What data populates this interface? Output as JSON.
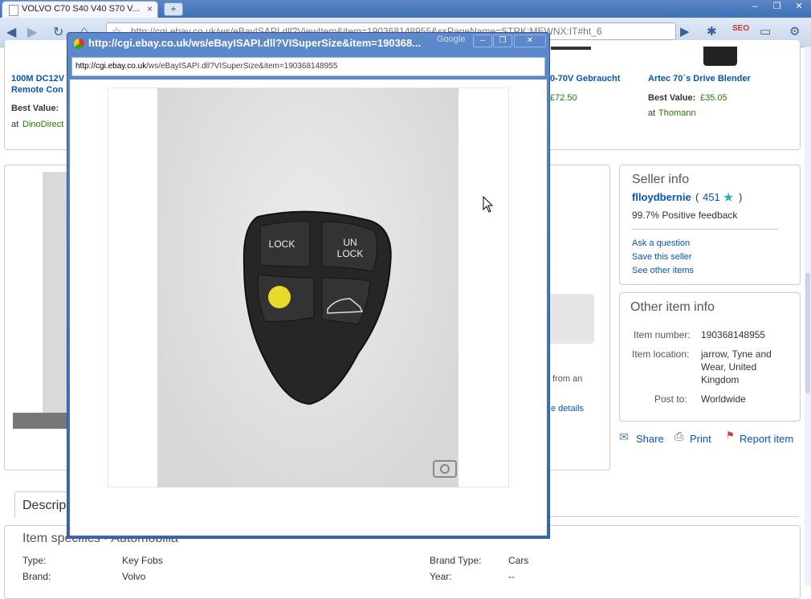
{
  "browser": {
    "tab_title": "VOLVO C70 S40 V40 S70 V...",
    "tab_close": "×",
    "new_tab": "+",
    "url": "http://cgi.ebay.co.uk/ws/eBayISAPI.dll?ViewItem&item=190368148955&ssPageName=STRK:MEWNX:IT#ht_6",
    "window_buttons": [
      "–",
      "❐",
      "✕"
    ]
  },
  "ads": [
    {
      "title_line1": "100M DC12V",
      "title_line2": "Remote Con",
      "best_value_label": "Best Value:",
      "store_label": "at",
      "store": "DinoDirect"
    },
    {
      "title_line1": "0-70V Gebraucht",
      "price": "£72.50"
    },
    {
      "title_line1": "Artec 70´s Drive Blender",
      "best_value_label": "Best Value:",
      "price": "£35.05",
      "store_label": "at",
      "store": "Thomann"
    }
  ],
  "seller": {
    "heading": "Seller info",
    "name": "flloydbernie",
    "feedback_open": "(",
    "feedback_score": "451",
    "feedback_close": ")",
    "positive": "99.7% Positive feedback",
    "links": [
      "Ask a question",
      "Save this seller",
      "See other items"
    ]
  },
  "other_info": {
    "heading": "Other item info",
    "item_number_label": "Item number:",
    "item_number": "190368148955",
    "location_label": "Item location:",
    "location_lines": [
      "jarrow, Tyne and",
      "Wear, United",
      "Kingdom"
    ],
    "post_label": "Post to:",
    "post": "Worldwide"
  },
  "actions": {
    "share": "Share",
    "print": "Print",
    "report": "Report item"
  },
  "middle": {
    "from_an": "from an",
    "details": "e details"
  },
  "description_tab": "Descrip",
  "specifics": {
    "heading": "Item specifics - Automobilia",
    "rows": [
      {
        "label": "Type:",
        "value": "Key Fobs",
        "label2": "Brand Type:",
        "value2": "Cars"
      },
      {
        "label": "Brand:",
        "value": "Volvo",
        "label2": "Year:",
        "value2": "--"
      }
    ]
  },
  "popup": {
    "title": "http://cgi.ebay.co.uk/ws/eBayISAPI.dll?VISuperSize&item=190368...",
    "google": "Google",
    "url_domain": "http://cgi.ebay.co.uk",
    "url_rest": "/ws/eBayISAPI.dll?VISuperSize&item=190368148955",
    "buttons": [
      "–",
      "❐",
      "✕"
    ],
    "fob": {
      "lock": "LOCK",
      "unlock_1": "UN",
      "unlock_2": "LOCK"
    }
  }
}
